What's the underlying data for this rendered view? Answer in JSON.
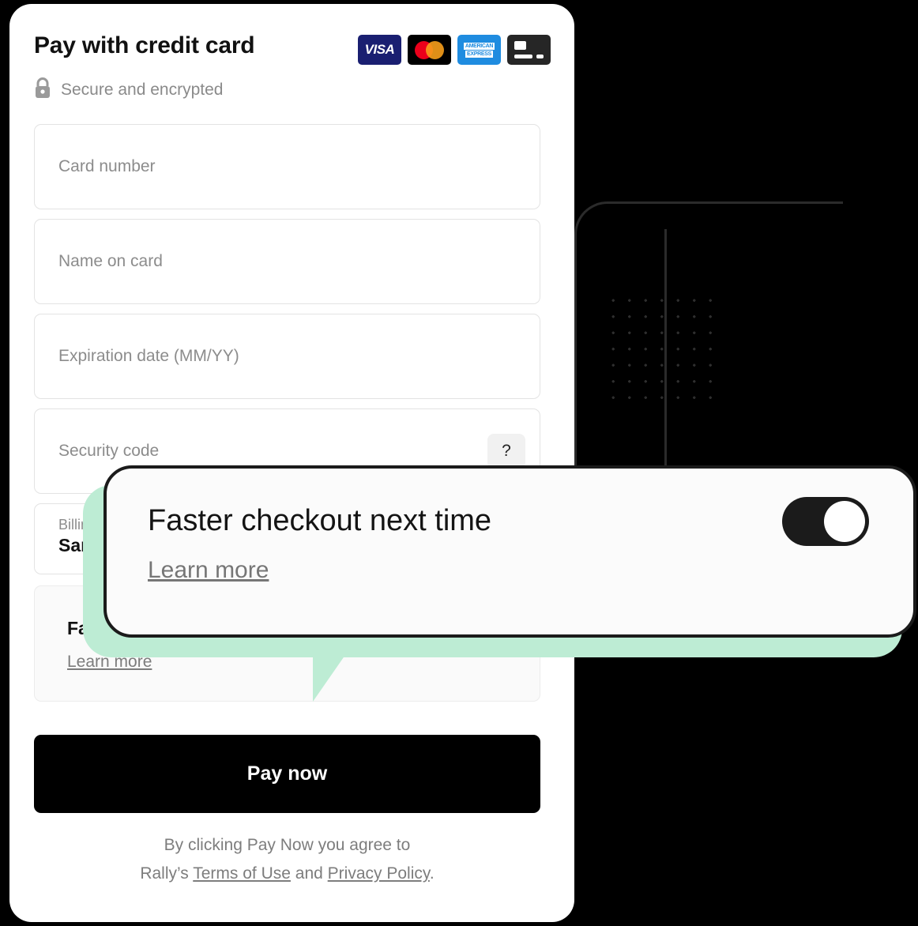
{
  "header": {
    "title": "Pay with credit card",
    "secure_note": "Secure and encrypted",
    "lock_icon": "lock-icon",
    "card_brands": [
      {
        "name": "visa",
        "label": "VISA"
      },
      {
        "name": "mastercard",
        "label": ""
      },
      {
        "name": "american-express",
        "label_line1": "AMERICAN",
        "label_line2": "EXPRESS"
      },
      {
        "name": "generic-card",
        "label": ""
      }
    ]
  },
  "form": {
    "fields": [
      {
        "name": "card-number",
        "placeholder": "Card number",
        "value": ""
      },
      {
        "name": "name-on-card",
        "placeholder": "Name on card",
        "value": ""
      },
      {
        "name": "expiration-date",
        "placeholder": "Expiration date (MM/YY)",
        "value": ""
      },
      {
        "name": "security-code",
        "placeholder": "Security code",
        "value": ""
      }
    ],
    "cvv_help_label": "?",
    "billing": {
      "label": "Billing address",
      "value": "Same as shipping address"
    },
    "faster_checkout": {
      "title": "Faster checkout next time",
      "link": "Learn more"
    }
  },
  "actions": {
    "pay_now_label": "Pay now"
  },
  "legal": {
    "line1": "By clicking Pay Now you agree to",
    "line2_prefix": "Rally’s ",
    "terms_link": "Terms of Use",
    "line2_middle": " and ",
    "privacy_link": "Privacy Policy",
    "line2_suffix": "."
  },
  "tooltip": {
    "title": "Faster checkout next time",
    "link": "Learn more",
    "toggle_state": "on"
  },
  "colors": {
    "background": "#000000",
    "card": "#ffffff",
    "accent_mint": "#bdecd4",
    "button": "#000000",
    "border": "#e3e3e3",
    "placeholder": "#8c8c8c"
  }
}
